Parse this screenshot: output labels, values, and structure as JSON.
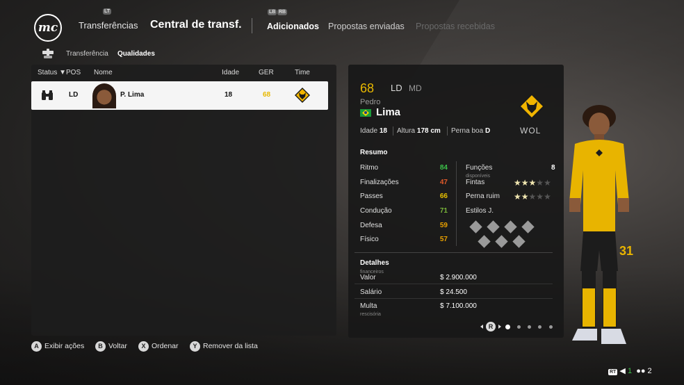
{
  "nav": {
    "logo": "mc",
    "transfers": "Transferências",
    "central": "Central de transf.",
    "tabs": [
      "Adicionados",
      "Propostas enviadas",
      "Propostas recebidas"
    ],
    "hint_lt": "LT",
    "hint_lb": "LB",
    "hint_rb": "RB"
  },
  "subnav": {
    "transfer": "Transferência",
    "qualities": "Qualidades"
  },
  "list": {
    "headers": {
      "status": "Status ▼",
      "pos": "POS",
      "name": "Nome",
      "age": "Idade",
      "ger": "GER",
      "team": "Time"
    },
    "rows": [
      {
        "pos": "LD",
        "name": "P. Lima",
        "age": "18",
        "ger": "68"
      }
    ]
  },
  "card": {
    "rating": "68",
    "pos_main": "LD",
    "pos_alt": "MD",
    "first_name": "Pedro",
    "last_name": "Lima",
    "club": "WOL",
    "age_label": "Idade",
    "age": "18",
    "height_label": "Altura",
    "height": "178 cm",
    "foot_label": "Perna boa",
    "foot": "D",
    "summary_title": "Resumo",
    "stats": [
      {
        "label": "Ritmo",
        "value": "84",
        "color": "#3cc24a"
      },
      {
        "label": "Finalizações",
        "value": "47",
        "color": "#e25a2a"
      },
      {
        "label": "Passes",
        "value": "66",
        "color": "#e8c000"
      },
      {
        "label": "Condução",
        "value": "71",
        "color": "#7ab63a"
      },
      {
        "label": "Defesa",
        "value": "59",
        "color": "#e8a000"
      },
      {
        "label": "Físico",
        "value": "57",
        "color": "#e8a000"
      }
    ],
    "roles_label": "Funções",
    "roles_sub": "disponíveis",
    "roles_value": "8",
    "skills_label": "Fintas",
    "skills_stars": 3,
    "weak_label": "Perna ruim",
    "weak_stars": 2,
    "styles_label": "Estilos J.",
    "fin_title": "Detalhes",
    "fin_title_sub": "financeiros",
    "value_label": "Valor",
    "value": "$ 2.900.000",
    "salary_label": "Salário",
    "salary": "$ 24.500",
    "fine_label": "Multa",
    "fine_sub": "rescisória",
    "fine": "$ 7.100.000",
    "pager_btn": "R"
  },
  "player_number": "31",
  "hints": [
    {
      "btn": "A",
      "label": "Exibir ações"
    },
    {
      "btn": "B",
      "label": "Voltar"
    },
    {
      "btn": "X",
      "label": "Ordenar"
    },
    {
      "btn": "Y",
      "label": "Remover da lista"
    }
  ],
  "status_bar": {
    "rt": "RT",
    "voice": "1",
    "players": "2"
  },
  "colors": {
    "accent": "#e8b800",
    "club_gold": "#f0b400",
    "club_black": "#1a1a1a"
  }
}
